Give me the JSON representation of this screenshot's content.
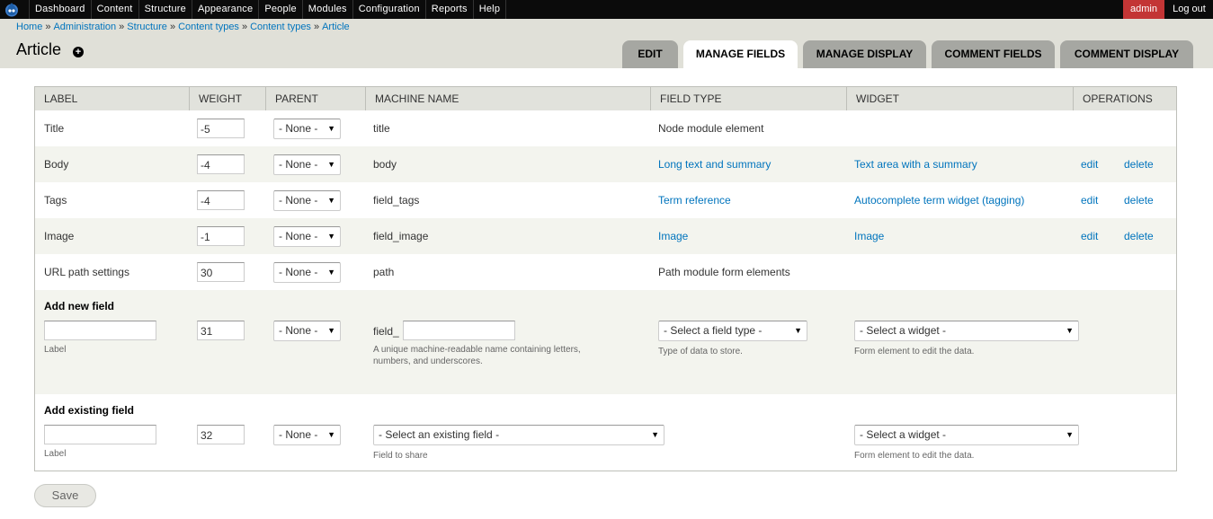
{
  "toolbar": {
    "menu": [
      "Dashboard",
      "Content",
      "Structure",
      "Appearance",
      "People",
      "Modules",
      "Configuration",
      "Reports",
      "Help"
    ],
    "user": "admin",
    "logout": "Log out"
  },
  "breadcrumb": [
    "Home",
    "Administration",
    "Structure",
    "Content types",
    "Content types",
    "Article"
  ],
  "page_title": "Article",
  "shortcut_symbol": "+",
  "tabs": [
    "EDIT",
    "MANAGE FIELDS",
    "MANAGE DISPLAY",
    "COMMENT FIELDS",
    "COMMENT DISPLAY"
  ],
  "active_tab": "MANAGE FIELDS",
  "table": {
    "headers": [
      "LABEL",
      "WEIGHT",
      "PARENT",
      "MACHINE NAME",
      "FIELD TYPE",
      "WIDGET",
      "OPERATIONS"
    ],
    "rows": [
      {
        "label": "Title",
        "weight": "-5",
        "parent": "- None -",
        "machine_name": "title",
        "field_type": "Node module element",
        "field_type_link": false,
        "widget": "",
        "edit": "",
        "delete": ""
      },
      {
        "label": "Body",
        "weight": "-4",
        "parent": "- None -",
        "machine_name": "body",
        "field_type": "Long text and summary",
        "field_type_link": true,
        "widget": "Text area with a summary",
        "edit": "edit",
        "delete": "delete"
      },
      {
        "label": "Tags",
        "weight": "-4",
        "parent": "- None -",
        "machine_name": "field_tags",
        "field_type": "Term reference",
        "field_type_link": true,
        "widget": "Autocomplete term widget (tagging)",
        "edit": "edit",
        "delete": "delete"
      },
      {
        "label": "Image",
        "weight": "-1",
        "parent": "- None -",
        "machine_name": "field_image",
        "field_type": "Image",
        "field_type_link": true,
        "widget": "Image",
        "edit": "edit",
        "delete": "delete"
      },
      {
        "label": "URL path settings",
        "weight": "30",
        "parent": "- None -",
        "machine_name": "path",
        "field_type": "Path module form elements",
        "field_type_link": false,
        "widget": "",
        "edit": "",
        "delete": ""
      }
    ]
  },
  "add_new_field": {
    "title": "Add new field",
    "label_value": "",
    "label_desc": "Label",
    "weight": "31",
    "parent": "- None -",
    "machine_prefix": "field_",
    "machine_value": "",
    "machine_desc_1": "A unique machine-readable name containing letters,",
    "machine_desc_2": "numbers, and underscores.",
    "field_type_select": "- Select a field type -",
    "field_type_desc": "Type of data to store.",
    "widget_select": "- Select a widget -",
    "widget_desc": "Form element to edit the data."
  },
  "add_existing_field": {
    "title": "Add existing field",
    "label_value": "",
    "label_desc": "Label",
    "weight": "32",
    "parent": "- None -",
    "existing_select": "- Select an existing field -",
    "existing_desc": "Field to share",
    "widget_select": "- Select a widget -",
    "widget_desc": "Form element to edit the data."
  },
  "save_label": "Save",
  "colors": {
    "toolbar_bg": "#0b0b0b",
    "admin_bg": "#c33535",
    "header_bg": "#e0e0d8",
    "link": "#0074bd",
    "tab_bg": "#a6a7a2"
  }
}
